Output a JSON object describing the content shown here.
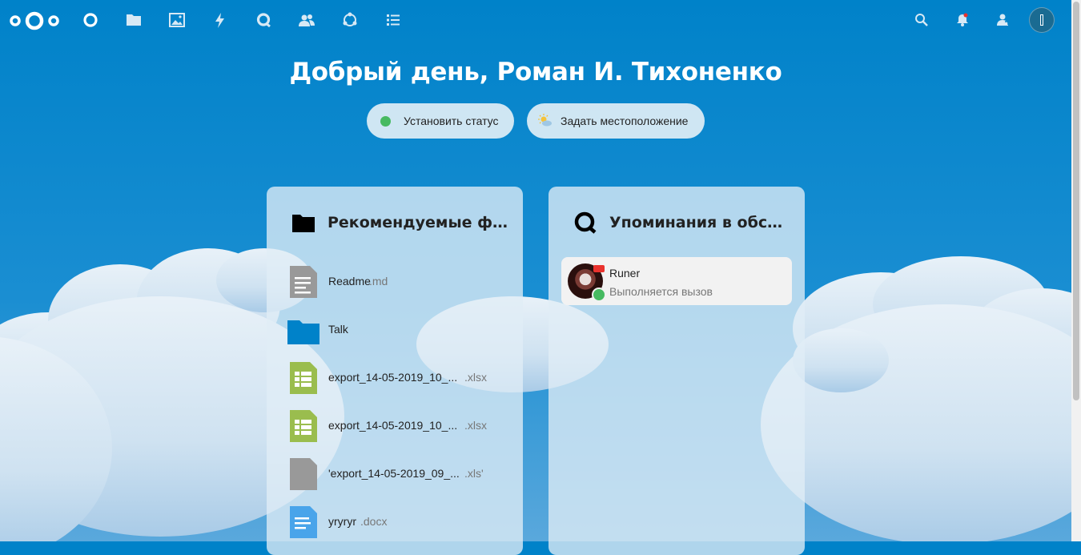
{
  "header": {
    "nav": [
      {
        "name": "dashboard-icon"
      },
      {
        "name": "files-icon"
      },
      {
        "name": "photos-icon"
      },
      {
        "name": "activity-icon"
      },
      {
        "name": "talk-icon"
      },
      {
        "name": "contacts-icon"
      },
      {
        "name": "circles-icon"
      },
      {
        "name": "tasks-icon"
      }
    ],
    "right": [
      "search-icon",
      "notifications-icon",
      "contacts-menu-icon",
      "user-avatar"
    ]
  },
  "greeting": "Добрый день, Роман И. Тихоненко",
  "status_button": "Установить статус",
  "location_button": "Задать местоположение",
  "recommended": {
    "title": "Рекомендуемые файлы",
    "files": [
      {
        "name": "Readme",
        "ext": ".md",
        "icon": "text-file-icon"
      },
      {
        "name": "Talk",
        "ext": "",
        "icon": "folder-icon"
      },
      {
        "name": "export_14-05-2019_10_...",
        "ext": ".xlsx",
        "icon": "spreadsheet-icon"
      },
      {
        "name": "export_14-05-2019_10_...",
        "ext": ".xlsx",
        "icon": "spreadsheet-icon"
      },
      {
        "name": "'export_14-05-2019_09_...",
        "ext": ".xls'",
        "icon": "generic-file-icon"
      },
      {
        "name": "yryryr",
        "ext": ".docx",
        "icon": "document-icon"
      }
    ]
  },
  "mentions": {
    "title": "Упоминания в обсуждениях",
    "items": [
      {
        "name": "Runer",
        "subtitle": "Выполняется вызов"
      }
    ]
  },
  "colors": {
    "primary": "#0082c9",
    "online": "#46ba61",
    "call": "#e9322d",
    "folder": "#0082c9",
    "spreadsheet": "#9abd4e",
    "document": "#49a4ea"
  }
}
